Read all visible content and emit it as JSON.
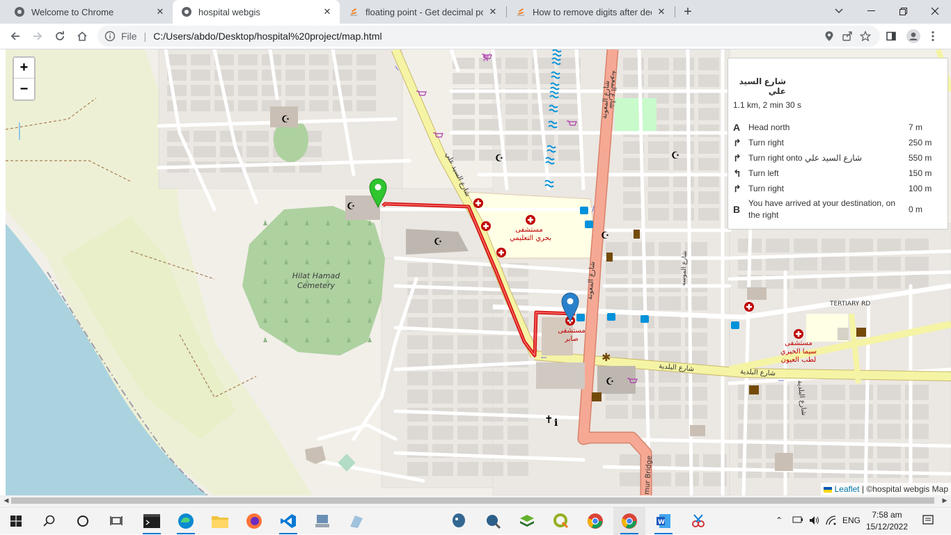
{
  "browser": {
    "tabs": [
      {
        "title": "Welcome to Chrome",
        "icon": "chrome-globe-icon",
        "active": false
      },
      {
        "title": "hospital webgis",
        "icon": "globe-icon",
        "active": true
      },
      {
        "title": "floating point - Get decimal porti",
        "icon": "stackoverflow-icon",
        "active": false
      },
      {
        "title": "How to remove digits after decim",
        "icon": "stackoverflow-icon",
        "active": false
      }
    ],
    "new_tab_label": "+",
    "address": {
      "scheme_label": "File",
      "separator": "|",
      "url": "C:/Users/abdo/Desktop/hospital%20project/map.html"
    }
  },
  "map": {
    "zoom_in": "+",
    "zoom_out": "−",
    "labels": {
      "cemetery": "Hilat Hamad\nCemetery",
      "cemetery_line1": "Hilat Hamad",
      "cemetery_line2": "Cemetery",
      "street_sayed_ali": "شارع السيد علي",
      "street_maouna_top": "شارع المعونة",
      "street_maouna_mid": "شارع المعونة",
      "street_maouna_low": "شارع المعونة",
      "street_baladia_1": "شارع البلدية",
      "street_baladia_2": "شارع البلدية",
      "street_baladia_v": "شارع البلدية",
      "street_mousa": "شارع الموسه",
      "tertiary": "TERTIARY RD",
      "bridge": "mur Bridge",
      "hospital_bahri_1": "مستشفى",
      "hospital_bahri_2": "بحري التعليمي",
      "hospital_sabar_1": "مستشفى",
      "hospital_sabar_2": "صابر",
      "hospital_sima_1": "مستشفى",
      "hospital_sima_2": "سيما الخيري",
      "hospital_sima_3": "لطب العيون"
    },
    "attribution": {
      "leaflet": "Leaflet",
      "rest": "| ©hospital webgis Map"
    }
  },
  "routing": {
    "road_name": "شارع السيد علي",
    "summary": "1.1 km, 2 min 30 s",
    "steps": [
      {
        "icon": "start-A-icon",
        "glyph": "A",
        "text": "Head north",
        "distance": "7 m"
      },
      {
        "icon": "turn-right-icon",
        "glyph": "↱",
        "text": "Turn right",
        "distance": "250 m"
      },
      {
        "icon": "turn-right-icon",
        "glyph": "↱",
        "text": "Turn right onto شارع السيد علي",
        "distance": "550 m"
      },
      {
        "icon": "turn-left-icon",
        "glyph": "↰",
        "text": "Turn left",
        "distance": "150 m"
      },
      {
        "icon": "turn-right-icon",
        "glyph": "↱",
        "text": "Turn right",
        "distance": "100 m"
      },
      {
        "icon": "end-B-icon",
        "glyph": "B",
        "text": "You have arrived at your destination, on the right",
        "distance": "0 m"
      }
    ]
  },
  "taskbar": {
    "language": "ENG",
    "time": "7:58 am",
    "date": "15/12/2022",
    "apps": [
      "windows-start-icon",
      "search-icon",
      "cortana-icon",
      "task-view-icon",
      "terminal-icon",
      "edge-icon",
      "file-explorer-icon",
      "firefox-icon",
      "vscode-icon",
      "network-app-icon",
      "app-icon",
      "postgresql-icon",
      "pgadmin-icon",
      "qgis-stack-icon",
      "qgis-icon",
      "chrome-icon",
      "chrome-icon",
      "word-icon",
      "snipping-icon"
    ]
  },
  "colors": {
    "route": "#d00000",
    "primary_road": "#f5a994",
    "secondary_road": "#f5f4a5",
    "water": "#aad3df",
    "cemetery": "#aed1a0",
    "hospital_area": "#ffffe5",
    "marker_start": "#2ec52e",
    "marker_end": "#2a81cb"
  }
}
